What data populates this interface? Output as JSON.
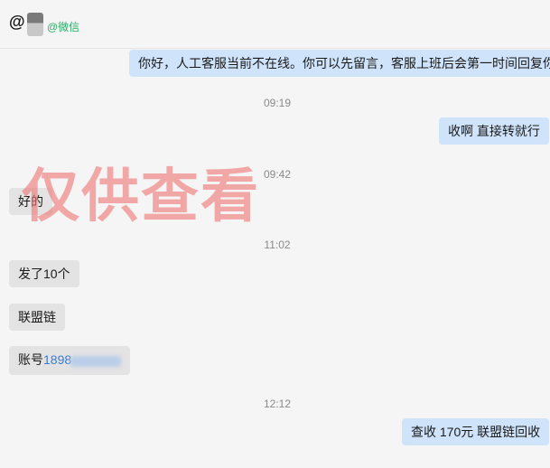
{
  "header": {
    "at_sign": "@",
    "wechat_tag": "@微信"
  },
  "messages": [
    {
      "type": "out",
      "text": "你好，人工客服当前不在线。你可以先留言，客服上班后会第一时间回复你。"
    },
    {
      "type": "time",
      "text": "09:19"
    },
    {
      "type": "out",
      "text": "收啊  直接转就行"
    },
    {
      "type": "time",
      "text": "09:42"
    },
    {
      "type": "in",
      "text": "好的"
    },
    {
      "type": "time",
      "text": "11:02"
    },
    {
      "type": "in",
      "text": "发了10个"
    },
    {
      "type": "in",
      "text": "联盟链"
    },
    {
      "type": "in",
      "label": "账号",
      "number": "1898"
    },
    {
      "type": "time",
      "text": "12:12"
    },
    {
      "type": "out",
      "text": "查收  170元 联盟链回收"
    }
  ],
  "watermark": "仅供查看",
  "colors": {
    "outgoing_bubble": "#cfe4fb",
    "incoming_bubble": "#e3e3e3",
    "wechat_green": "#2aae67",
    "number_blue": "#3b7ad6",
    "watermark_red": "#f07878"
  }
}
